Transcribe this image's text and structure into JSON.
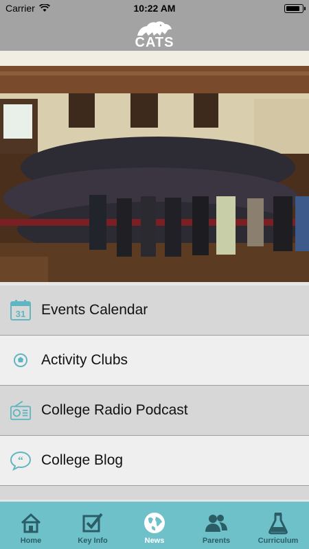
{
  "status_bar": {
    "carrier": "Carrier",
    "time": "10:22 AM",
    "battery_level": 0.85
  },
  "header": {
    "logo_text": "CATS"
  },
  "menu": {
    "items": [
      {
        "label": "Events Calendar",
        "icon": "calendar-icon",
        "calendar_day": "31"
      },
      {
        "label": "Activity Clubs",
        "icon": "football-icon"
      },
      {
        "label": "College Radio Podcast",
        "icon": "radio-icon"
      },
      {
        "label": "College Blog",
        "icon": "speech-bubble-icon"
      }
    ]
  },
  "tabbar": {
    "tabs": [
      {
        "label": "Home",
        "icon": "home-icon",
        "active": false
      },
      {
        "label": "Key Info",
        "icon": "checkbox-icon",
        "active": false
      },
      {
        "label": "News",
        "icon": "globe-icon",
        "active": true
      },
      {
        "label": "Parents",
        "icon": "people-icon",
        "active": false
      },
      {
        "label": "Curriculum",
        "icon": "flask-icon",
        "active": false
      }
    ]
  },
  "colors": {
    "tabbar_bg": "#6fc1c9",
    "icon_teal": "#5fb6c2",
    "header_bg": "#a3a3a3",
    "active_tab": "#ffffff"
  }
}
